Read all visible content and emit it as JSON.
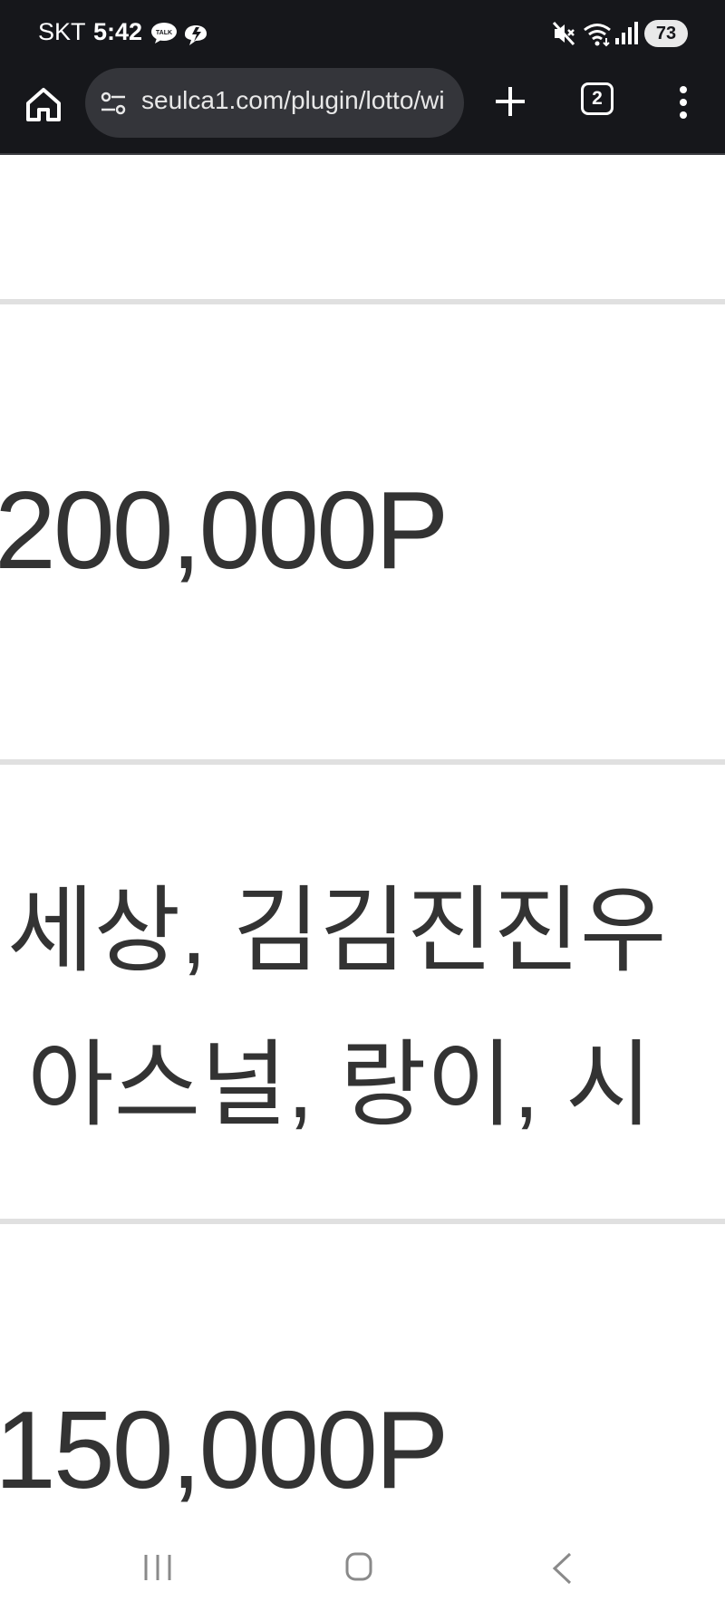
{
  "status_bar": {
    "carrier": "SKT",
    "time": "5:42",
    "talk_badge": "TALK",
    "battery": "73",
    "icons": [
      "talk-icon",
      "chat-bubble-icon",
      "mute-icon",
      "wifi-icon",
      "signal-icon",
      "battery-icon"
    ]
  },
  "browser": {
    "url": "seulca1.com/plugin/lotto/wi",
    "tab_count": "2",
    "icons": [
      "home-icon",
      "site-settings-icon",
      "new-tab-icon",
      "tab-switcher-icon",
      "more-menu-icon"
    ]
  },
  "content": {
    "prize_1": "200,000P",
    "winners_line_1": "세상, 김김진진우",
    "winners_line_2": "아스널, 랑이, 시",
    "prize_2": "150,000P"
  },
  "nav_bar": {
    "icons": [
      "recent-apps-icon",
      "home-nav-icon",
      "back-icon"
    ]
  },
  "colors": {
    "chrome_bg": "#16171b",
    "urlbar_bg": "#34353a",
    "text": "#333333",
    "divider": "#e0e0e0"
  }
}
